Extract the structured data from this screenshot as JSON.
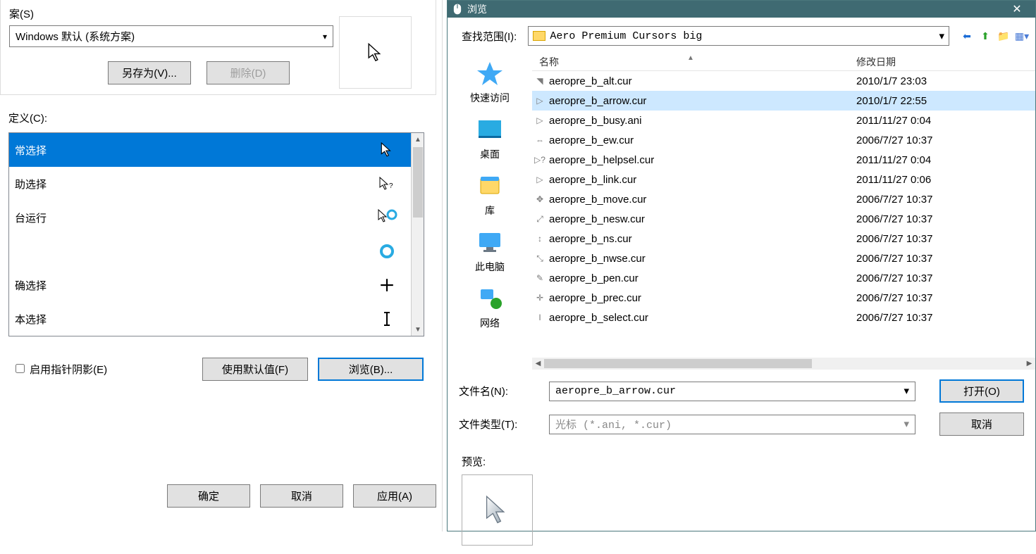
{
  "scheme": {
    "title": "案(S)",
    "combo_value": "Windows 默认 (系统方案)",
    "save_as": "另存为(V)...",
    "delete": "删除(D)"
  },
  "custom_title": "定义(C):",
  "cursor_items": [
    {
      "label": "常选择",
      "icon": "arrow",
      "selected": true
    },
    {
      "label": "助选择",
      "icon": "arrow-help"
    },
    {
      "label": "台运行",
      "icon": "arrow-busy"
    },
    {
      "label": "",
      "icon": "busy"
    },
    {
      "label": "确选择",
      "icon": "cross"
    },
    {
      "label": "本选择",
      "icon": "ibeam"
    }
  ],
  "shadow_label": "启用指针阴影(E)",
  "use_default": "使用默认值(F)",
  "browse": "浏览(B)...",
  "dialog_buttons": {
    "ok": "确定",
    "cancel": "取消",
    "apply": "应用(A)"
  },
  "browse_dlg": {
    "title": "浏览",
    "lookin_label": "查找范围(I):",
    "lookin_value": "Aero Premium Cursors big",
    "places": [
      {
        "label": "快速访问",
        "icon": "star"
      },
      {
        "label": "桌面",
        "icon": "desktop"
      },
      {
        "label": "库",
        "icon": "library"
      },
      {
        "label": "此电脑",
        "icon": "pc"
      },
      {
        "label": "网络",
        "icon": "network"
      }
    ],
    "columns": {
      "name": "名称",
      "date": "修改日期"
    },
    "files": [
      {
        "name": "aeropre_b_alt.cur",
        "date": "2010/1/7 23:03",
        "icon": "◥"
      },
      {
        "name": "aeropre_b_arrow.cur",
        "date": "2010/1/7 22:55",
        "icon": "▷",
        "selected": true
      },
      {
        "name": "aeropre_b_busy.ani",
        "date": "2011/11/27 0:04",
        "icon": "▷"
      },
      {
        "name": "aeropre_b_ew.cur",
        "date": "2006/7/27 10:37",
        "icon": "⇔"
      },
      {
        "name": "aeropre_b_helpsel.cur",
        "date": "2011/11/27 0:04",
        "icon": "▷?"
      },
      {
        "name": "aeropre_b_link.cur",
        "date": "2011/11/27 0:06",
        "icon": "▷"
      },
      {
        "name": "aeropre_b_move.cur",
        "date": "2006/7/27 10:37",
        "icon": "✥"
      },
      {
        "name": "aeropre_b_nesw.cur",
        "date": "2006/7/27 10:37",
        "icon": "⤢"
      },
      {
        "name": "aeropre_b_ns.cur",
        "date": "2006/7/27 10:37",
        "icon": "↕"
      },
      {
        "name": "aeropre_b_nwse.cur",
        "date": "2006/7/27 10:37",
        "icon": "⤡"
      },
      {
        "name": "aeropre_b_pen.cur",
        "date": "2006/7/27 10:37",
        "icon": "✎"
      },
      {
        "name": "aeropre_b_prec.cur",
        "date": "2006/7/27 10:37",
        "icon": "✛"
      },
      {
        "name": "aeropre_b_select.cur",
        "date": "2006/7/27 10:37",
        "icon": "I"
      }
    ],
    "filename_label": "文件名(N):",
    "filename_value": "aeropre_b_arrow.cur",
    "filetype_label": "文件类型(T):",
    "filetype_value": "光标 (*.ani, *.cur)",
    "open": "打开(O)",
    "cancel": "取消",
    "preview_label": "预览:"
  }
}
